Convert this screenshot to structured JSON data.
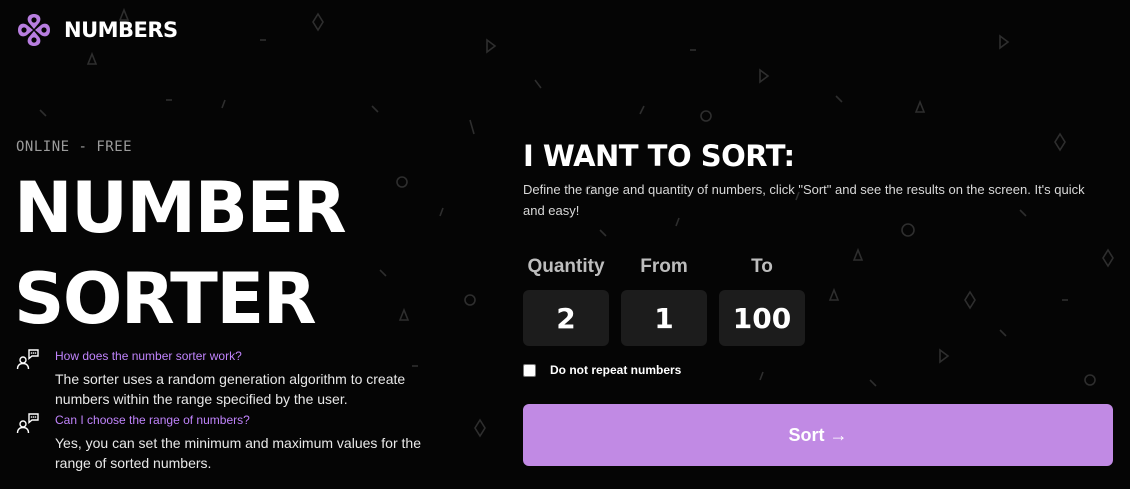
{
  "header": {
    "brand": "NUMBERS"
  },
  "hero": {
    "kicker": "ONLINE - FREE",
    "title_line1": "NUMBER",
    "title_line2": "SORTER"
  },
  "faq": [
    {
      "question": "How does the number sorter work?",
      "answer": "The sorter uses a random generation algorithm to create numbers within the range specified by the user.",
      "icon": "chat-people-icon"
    },
    {
      "question": "Can I choose the range of numbers?",
      "answer": "Yes, you can set the minimum and maximum values for the range of sorted numbers.",
      "icon": "chat-people-icon"
    }
  ],
  "form": {
    "title": "I WANT TO SORT:",
    "description": "Define the range and quantity of numbers, click \"Sort\" and see the results on the screen. It's quick and easy!",
    "quantity_label": "Quantity",
    "quantity_value": "2",
    "from_label": "From",
    "from_value": "1",
    "to_label": "To",
    "to_value": "100",
    "no_repeat_label": "Do not repeat numbers",
    "no_repeat_checked": false,
    "submit_label": "Sort →"
  },
  "colors": {
    "background": "#050505",
    "accent": "#c18ae4",
    "faq_question": "#c084fc",
    "input_bg": "#1c1c1c"
  }
}
